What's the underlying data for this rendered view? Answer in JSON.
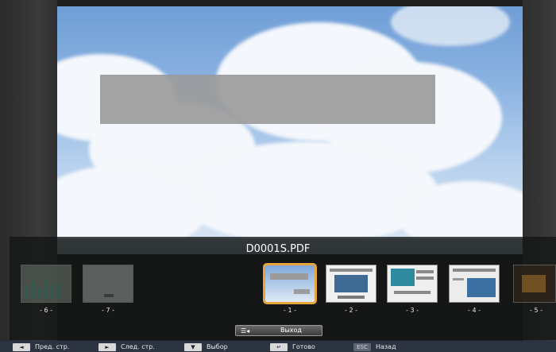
{
  "file_name": "D0001S.PDF",
  "thumbnails": [
    {
      "label": "- 6 -"
    },
    {
      "label": "- 7 -"
    },
    {
      "label": "- 1 -",
      "selected": true
    },
    {
      "label": "- 2 -"
    },
    {
      "label": "- 3 -"
    },
    {
      "label": "- 4 -"
    },
    {
      "label": "- 5 -"
    }
  ],
  "exit_button": {
    "label": "Выход",
    "icon": "menu-key-icon"
  },
  "footer": [
    {
      "key": "◄",
      "label": "Пред. стр."
    },
    {
      "key": "►",
      "label": "След. стр."
    },
    {
      "key": "▼",
      "label": "Выбор"
    },
    {
      "key": "↵",
      "label": "Готово"
    },
    {
      "key": "ESC",
      "label": "Назад"
    }
  ],
  "colors": {
    "selection": "#e7a53a",
    "footer_bg": "#2b3440"
  }
}
